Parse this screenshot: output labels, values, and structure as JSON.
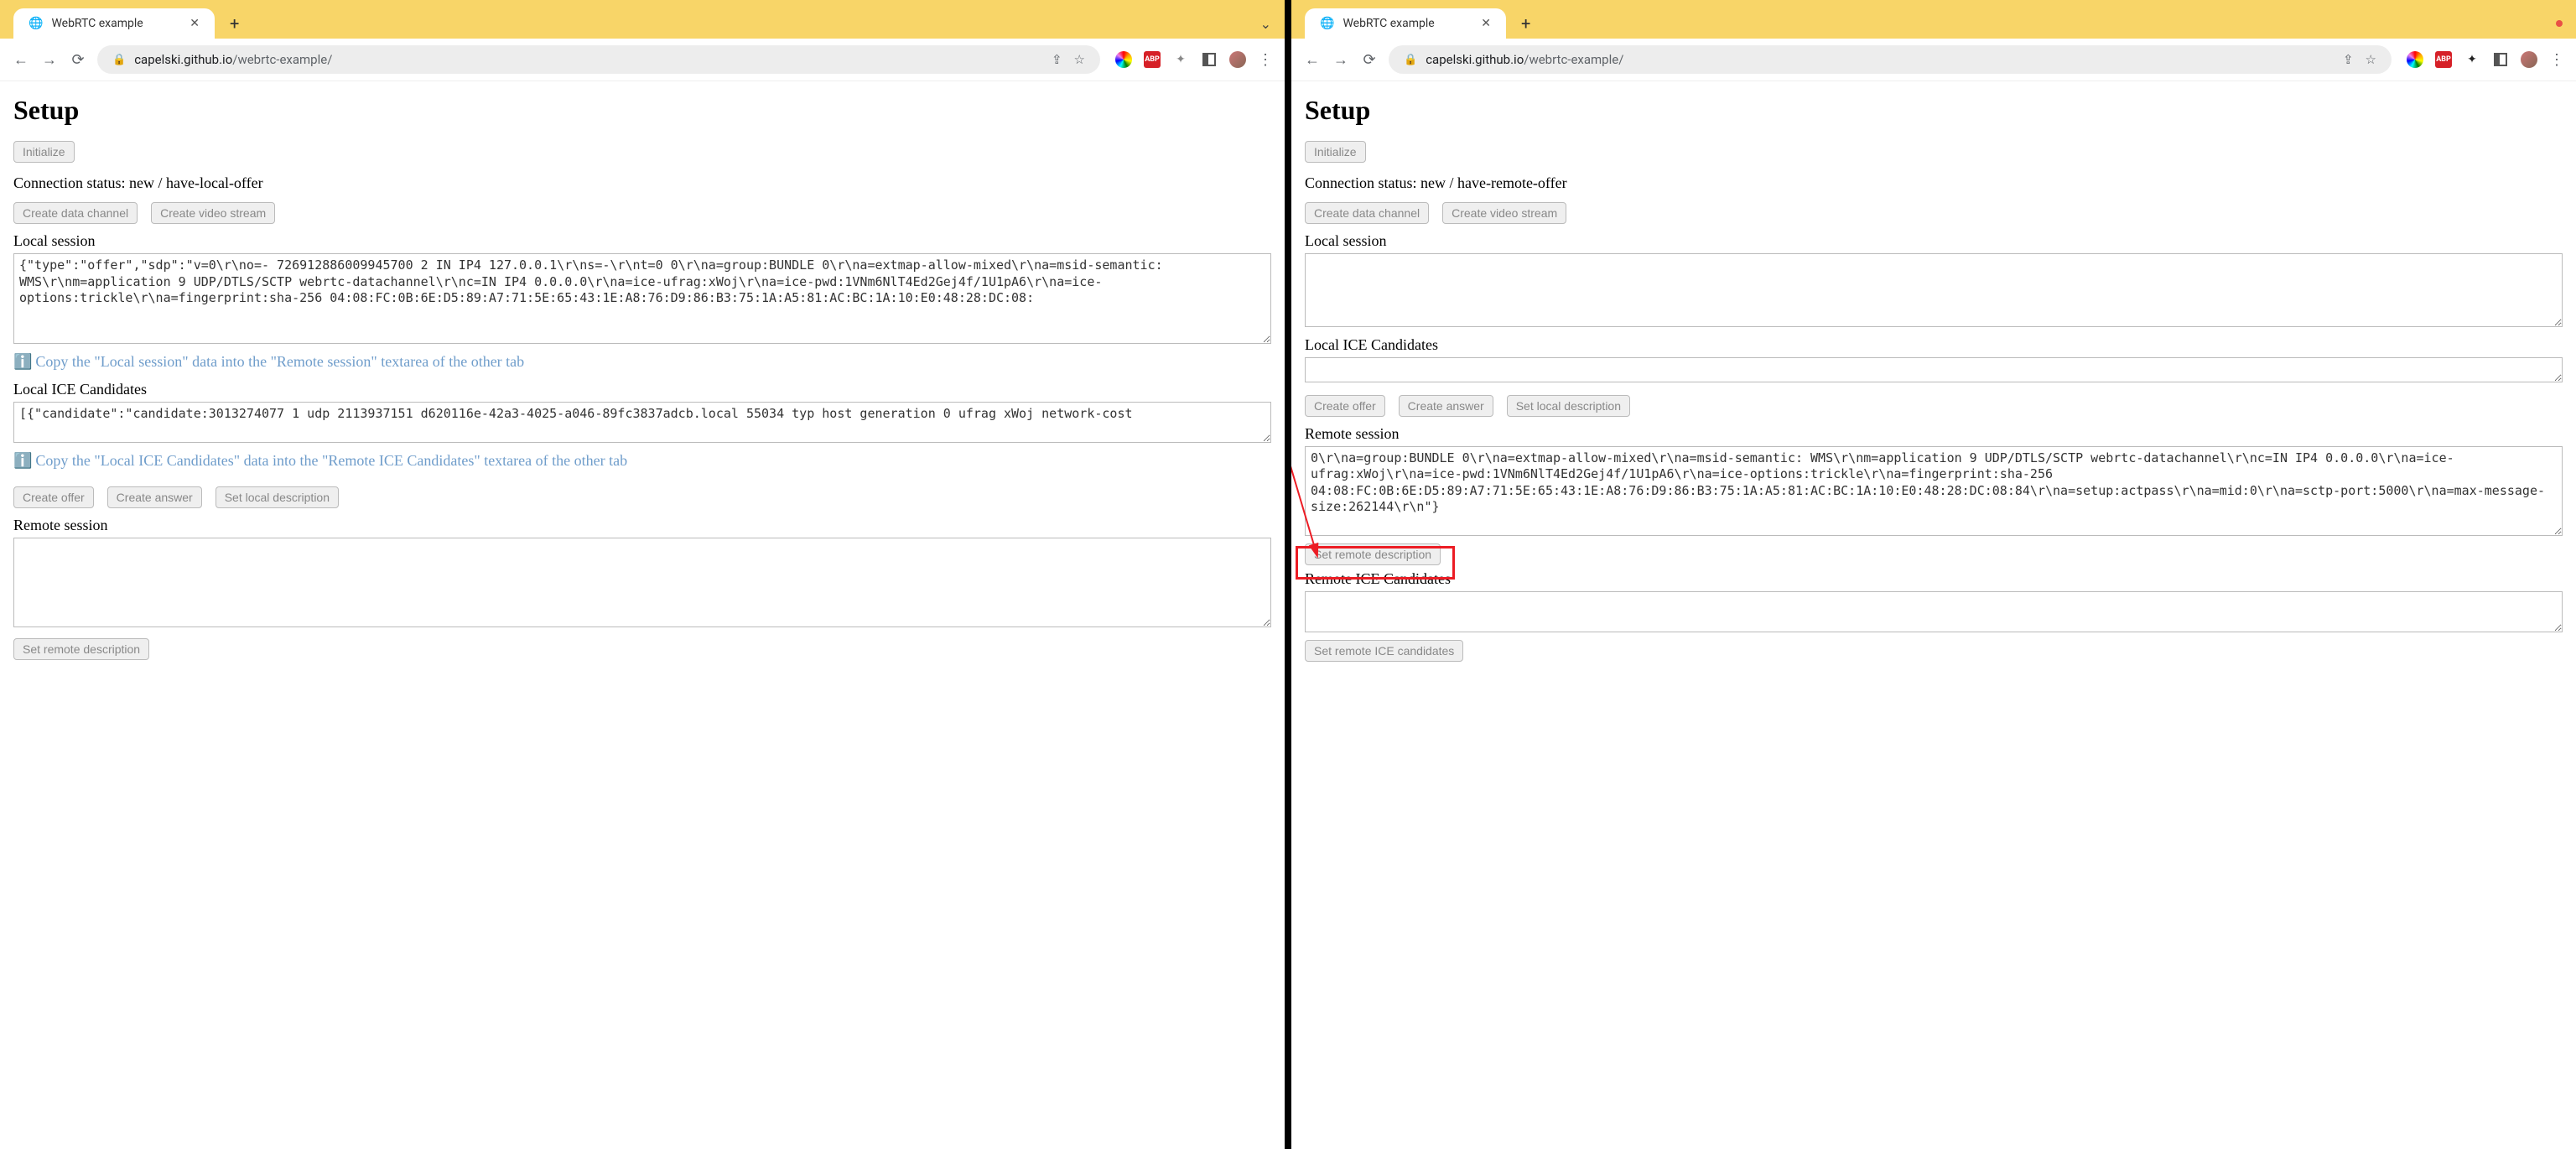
{
  "left": {
    "tab_title": "WebRTC example",
    "url_host": "capelski.github.io",
    "url_path": "/webrtc-example/",
    "heading": "Setup",
    "initialize_btn": "Initialize",
    "status_label": "Connection status:",
    "status_value": "new / have-local-offer",
    "create_data_channel": "Create data channel",
    "create_video_stream": "Create video stream",
    "local_session_label": "Local session",
    "local_session_text": "{\"type\":\"offer\",\"sdp\":\"v=0\\r\\no=- 726912886009945700 2 IN IP4 127.0.0.1\\r\\ns=-\\r\\nt=0 0\\r\\na=group:BUNDLE 0\\r\\na=extmap-allow-mixed\\r\\na=msid-semantic: WMS\\r\\nm=application 9 UDP/DTLS/SCTP webrtc-datachannel\\r\\nc=IN IP4 0.0.0.0\\r\\na=ice-ufrag:xWoj\\r\\na=ice-pwd:1VNm6NlT4Ed2Gej4f/1U1pA6\\r\\na=ice-options:trickle\\r\\na=fingerprint:sha-256 04:08:FC:0B:6E:D5:89:A7:71:5E:65:43:1E:A8:76:D9:86:B3:75:1A:A5:81:AC:BC:1A:10:E0:48:28:DC:08:",
    "tip1": "Copy the \"Local session\" data into the \"Remote session\" textarea of the other tab",
    "local_ice_label": "Local ICE Candidates",
    "local_ice_text": "[{\"candidate\":\"candidate:3013274077 1 udp 2113937151 d620116e-42a3-4025-a046-89fc3837adcb.local 55034 typ host generation 0 ufrag xWoj network-cost",
    "tip2": "Copy the \"Local ICE Candidates\" data into the \"Remote ICE Candidates\" textarea of the other tab",
    "create_offer": "Create offer",
    "create_answer": "Create answer",
    "set_local_desc": "Set local description",
    "remote_session_label": "Remote session",
    "remote_session_text": "",
    "set_remote_desc": "Set remote description"
  },
  "right": {
    "tab_title": "WebRTC example",
    "url_host": "capelski.github.io",
    "url_path": "/webrtc-example/",
    "heading": "Setup",
    "initialize_btn": "Initialize",
    "status_label": "Connection status:",
    "status_value": "new / have-remote-offer",
    "create_data_channel": "Create data channel",
    "create_video_stream": "Create video stream",
    "local_session_label": "Local session",
    "local_session_text": "",
    "local_ice_label": "Local ICE Candidates",
    "local_ice_text": "",
    "create_offer": "Create offer",
    "create_answer": "Create answer",
    "set_local_desc": "Set local description",
    "remote_session_label": "Remote session",
    "remote_session_text": "0\\r\\na=group:BUNDLE 0\\r\\na=extmap-allow-mixed\\r\\na=msid-semantic: WMS\\r\\nm=application 9 UDP/DTLS/SCTP webrtc-datachannel\\r\\nc=IN IP4 0.0.0.0\\r\\na=ice-ufrag:xWoj\\r\\na=ice-pwd:1VNm6NlT4Ed2Gej4f/1U1pA6\\r\\na=ice-options:trickle\\r\\na=fingerprint:sha-256 04:08:FC:0B:6E:D5:89:A7:71:5E:65:43:1E:A8:76:D9:86:B3:75:1A:A5:81:AC:BC:1A:10:E0:48:28:DC:08:84\\r\\na=setup:actpass\\r\\na=mid:0\\r\\na=sctp-port:5000\\r\\na=max-message-size:262144\\r\\n\"}",
    "set_remote_desc": "Set remote description",
    "remote_ice_label": "Remote ICE Candidates",
    "remote_ice_text": "",
    "set_remote_ice": "Set remote ICE candidates"
  },
  "info_emoji": "ℹ️"
}
